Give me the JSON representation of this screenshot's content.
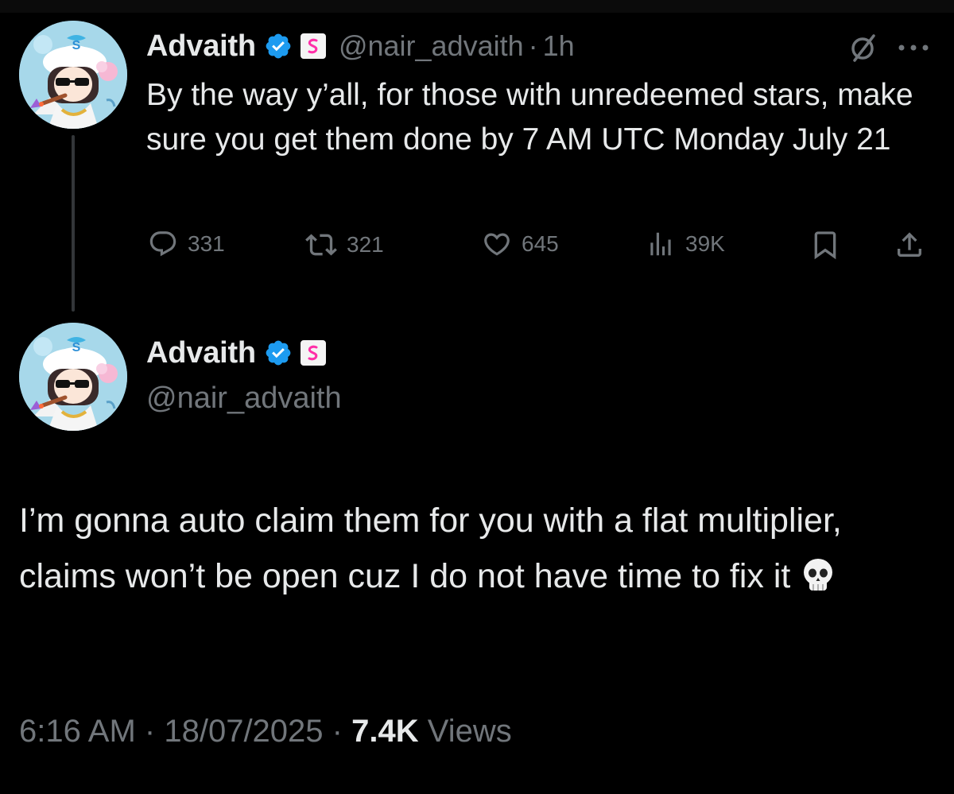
{
  "colors": {
    "background": "#000000",
    "text_primary": "#e7e9ea",
    "text_secondary": "#71767b",
    "verified_blue": "#1d9bf0",
    "thread_line": "#333639"
  },
  "parent_post": {
    "display_name": "Advaith",
    "handle": "@nair_advaith",
    "separator": "·",
    "age": "1h",
    "text": "By the way y’all, for those with unredeemed stars, make sure you get them done by 7 AM UTC Monday July 21",
    "actions": {
      "replies": "331",
      "reposts": "321",
      "likes": "645",
      "views": "39K"
    }
  },
  "main_post": {
    "display_name": "Advaith",
    "handle": "@nair_advaith",
    "text": "I’m gonna auto claim them for you with a flat multiplier, claims won’t be open cuz I do not have time to fix it",
    "emoji": "skull-icon",
    "time": "6:16 AM",
    "separator": "·",
    "date": "18/07/2025",
    "views_count": "7.4K",
    "views_label": "Views"
  }
}
